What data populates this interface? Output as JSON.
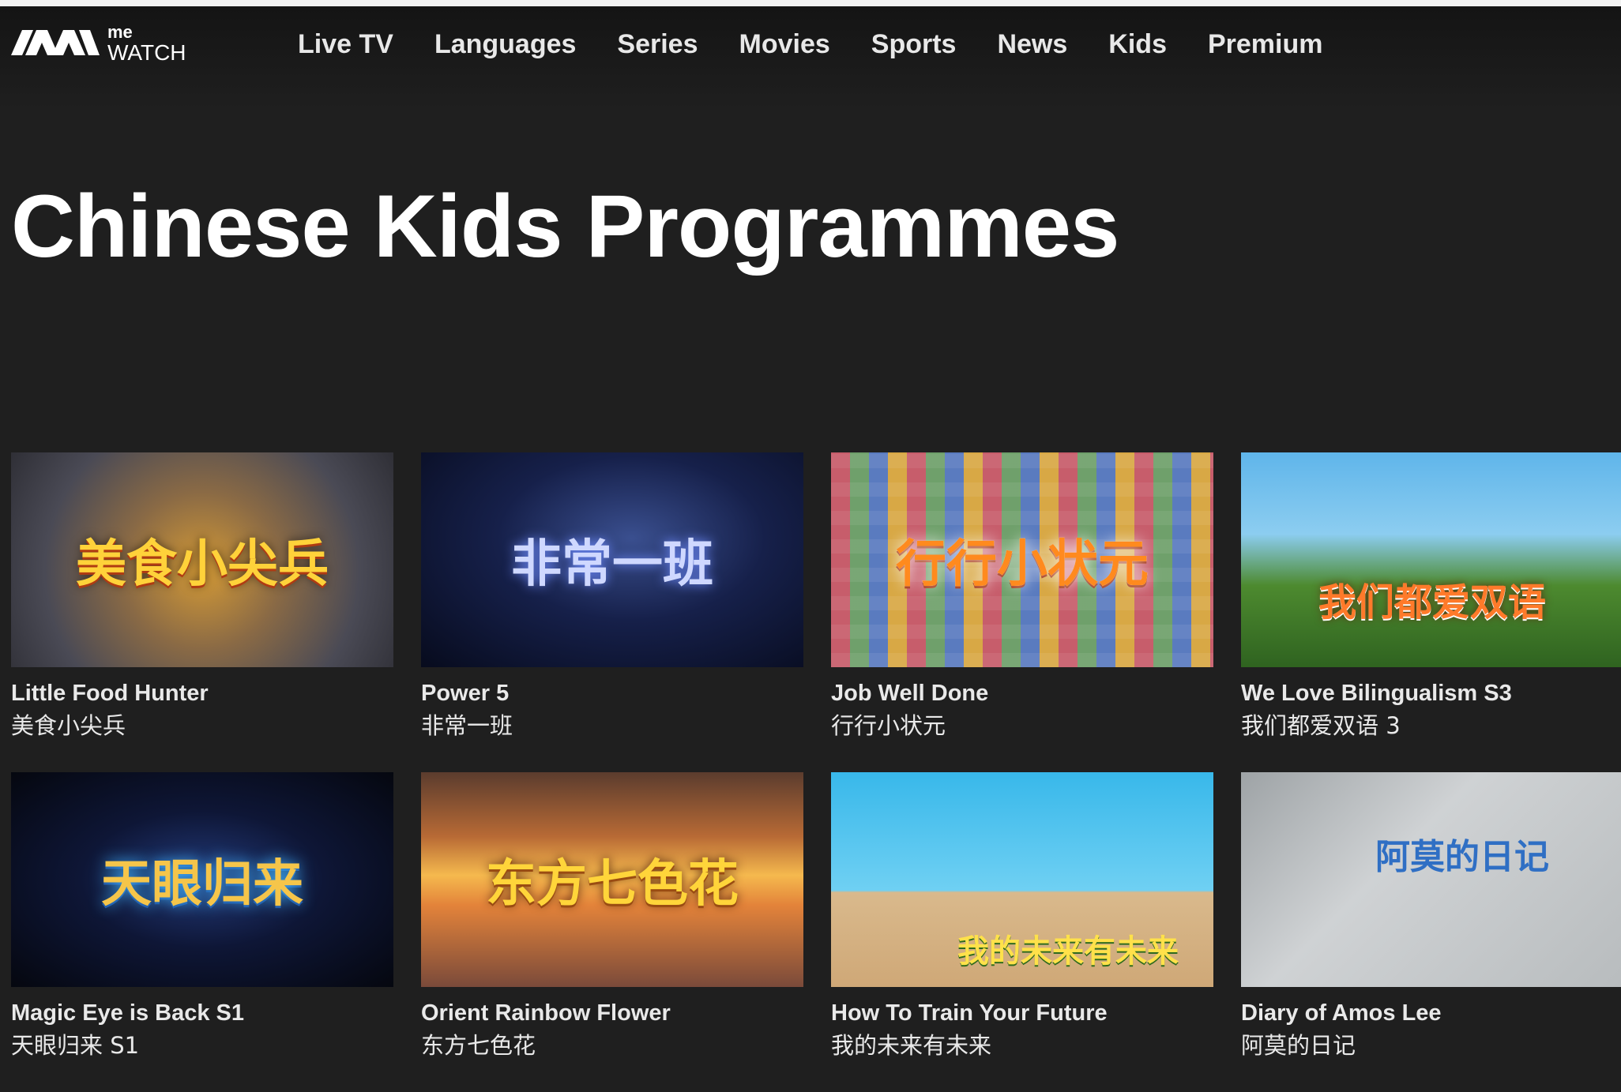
{
  "brand": {
    "logo_me": "me",
    "logo_watch": "WATCH"
  },
  "nav": {
    "items": [
      {
        "label": "Live TV"
      },
      {
        "label": "Languages"
      },
      {
        "label": "Series"
      },
      {
        "label": "Movies"
      },
      {
        "label": "Sports"
      },
      {
        "label": "News"
      },
      {
        "label": "Kids"
      },
      {
        "label": "Premium"
      }
    ]
  },
  "page": {
    "title": "Chinese Kids Programmes"
  },
  "programmes": [
    {
      "title": "Little Food Hunter",
      "subtitle": "美食小尖兵",
      "thumb_text": "美食小尖兵"
    },
    {
      "title": "Power 5",
      "subtitle": "非常一班",
      "thumb_text": "非常一班"
    },
    {
      "title": "Job Well Done",
      "subtitle": "行行小状元",
      "thumb_text": "行行小状元"
    },
    {
      "title": "We Love Bilingualism S3",
      "subtitle": "我们都爱双语 3",
      "thumb_text": "我们都爱双语"
    },
    {
      "title": "Magic Eye is Back S1",
      "subtitle": "天眼归来 S1",
      "thumb_text": "天眼归来"
    },
    {
      "title": "Orient Rainbow Flower",
      "subtitle": "东方七色花",
      "thumb_text": "东方七色花"
    },
    {
      "title": "How To Train Your Future",
      "subtitle": "我的未来有未来",
      "thumb_text": "我的未来有未来"
    },
    {
      "title": "Diary of Amos Lee",
      "subtitle": "阿莫的日记",
      "thumb_text": "阿莫的日记"
    }
  ]
}
